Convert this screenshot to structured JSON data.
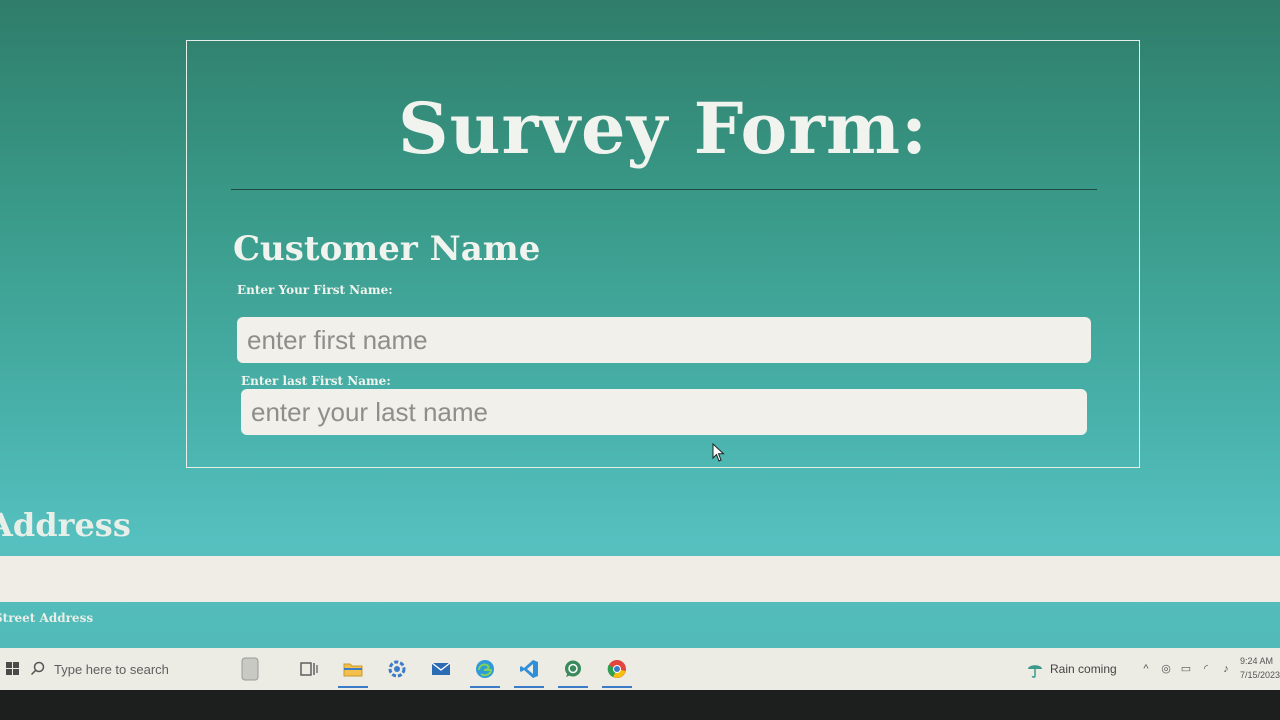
{
  "form": {
    "title": "Survey Form:",
    "section_heading": "Customer Name",
    "first_name": {
      "label": "Enter Your First Name:",
      "placeholder": "enter first name",
      "value": ""
    },
    "last_name": {
      "label": "Enter last First Name:",
      "placeholder": "enter your last name",
      "value": ""
    }
  },
  "address": {
    "heading": "Address",
    "street_label": "Street Address"
  },
  "taskbar": {
    "search_placeholder": "Type here to search",
    "weather_text": "Rain coming",
    "time": "9:24 AM",
    "date": "7/15/2023",
    "icons": [
      "windows-start-icon",
      "search-icon",
      "task-view-icon",
      "file-explorer-icon",
      "settings-icon",
      "mail-icon",
      "edge-icon",
      "vscode-icon",
      "whatsapp-icon",
      "chrome-icon"
    ]
  },
  "colors": {
    "background_top": "#2f7d6a",
    "background_bottom": "#55c0bf",
    "heading_text": "#f1f4ee",
    "input_background": "#f2f0ea",
    "taskbar": "#ecebe4"
  }
}
